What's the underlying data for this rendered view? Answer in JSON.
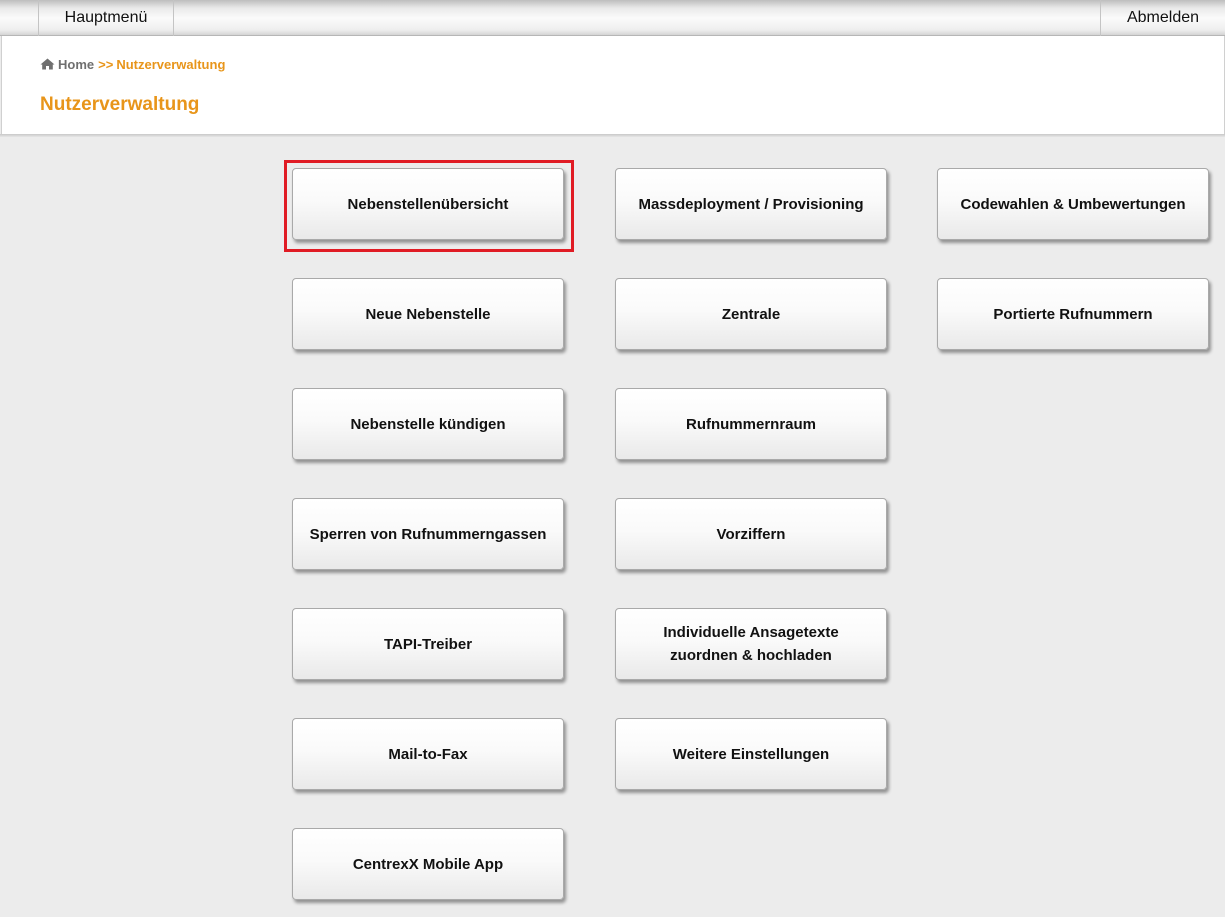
{
  "topbar": {
    "main_menu_label": "Hauptmenü",
    "logout_label": "Abmelden"
  },
  "breadcrumb": {
    "home_label": "Home",
    "separator": ">>",
    "current_label": "Nutzerverwaltung"
  },
  "page_title": "Nutzerverwaltung",
  "accent_color": "#e8951a",
  "highlight_color": "#e01b24",
  "tiles": {
    "col1": [
      "Nebenstellenübersicht",
      "Neue Nebenstelle",
      "Nebenstelle kündigen",
      "Sperren von Rufnummerngassen",
      "TAPI-Treiber",
      "Mail-to-Fax",
      "CentrexX Mobile App"
    ],
    "col2": [
      "Massdeployment / Provisioning",
      "Zentrale",
      "Rufnummernraum",
      "Vorziffern",
      "Individuelle Ansagetexte\nzuordnen & hochladen",
      "Weitere Einstellungen"
    ],
    "col3": [
      "Codewahlen & Umbewertungen",
      "Portierte Rufnummern"
    ]
  },
  "highlighted_tile": "Nebenstellenübersicht"
}
